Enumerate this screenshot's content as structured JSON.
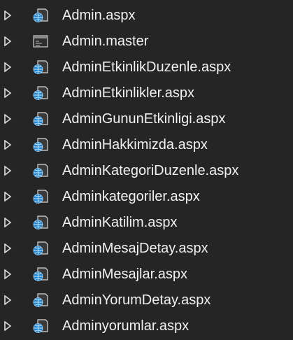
{
  "explorer": {
    "items": [
      {
        "label": "Admin.aspx",
        "icon": "aspx-file-icon"
      },
      {
        "label": "Admin.master",
        "icon": "master-page-icon"
      },
      {
        "label": "AdminEtkinlikDuzenle.aspx",
        "icon": "aspx-file-icon"
      },
      {
        "label": "AdminEtkinlikler.aspx",
        "icon": "aspx-file-icon"
      },
      {
        "label": "AdminGununEtkinligi.aspx",
        "icon": "aspx-file-icon"
      },
      {
        "label": "AdminHakkimizda.aspx",
        "icon": "aspx-file-icon"
      },
      {
        "label": "AdminKategoriDuzenle.aspx",
        "icon": "aspx-file-icon"
      },
      {
        "label": "Adminkategoriler.aspx",
        "icon": "aspx-file-icon"
      },
      {
        "label": "AdminKatilim.aspx",
        "icon": "aspx-file-icon"
      },
      {
        "label": "AdminMesajDetay.aspx",
        "icon": "aspx-file-icon"
      },
      {
        "label": "AdminMesajlar.aspx",
        "icon": "aspx-file-icon"
      },
      {
        "label": "AdminYorumDetay.aspx",
        "icon": "aspx-file-icon"
      },
      {
        "label": "Adminyorumlar.aspx",
        "icon": "aspx-file-icon"
      }
    ],
    "colors": {
      "background": "#252526",
      "text": "#f1f1f1",
      "expander": "#dcdcdc",
      "globe": "#1f86d6",
      "page": "#3a3a3a"
    }
  }
}
